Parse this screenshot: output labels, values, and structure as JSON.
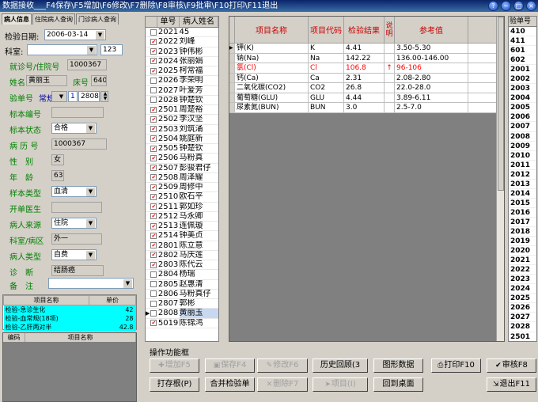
{
  "window": {
    "title": "数据接收___F4保存\\F5增加\\F6修改\\F7删除\\F8审核\\F9批审\\F10打印\\F11退出"
  },
  "tabs": [
    "病人信息",
    "住院病人查询",
    "门诊病人查询"
  ],
  "form": {
    "test_date_label": "检验日期:",
    "test_date": "2006-03-14",
    "dept_label": "科室:",
    "dept_value": "",
    "dept_code": "123",
    "visit_no_label": "就诊号/住院号",
    "visit_no": "1000367",
    "name_label": "姓名",
    "name": "黄丽玉",
    "bed_label": "床号",
    "bed": "640",
    "test_no_label": "验单号",
    "test_type": "常规",
    "test_flag": "1",
    "test_no": "2808",
    "specimen_no_label": "标本编号",
    "specimen_no": "",
    "specimen_state_label": "标本状态",
    "specimen_state": "合格",
    "record_no_label": "病 历 号",
    "record_no": "1000367",
    "sex_label": "性　别",
    "sex": "女",
    "age_label": "年　龄",
    "age": "63",
    "sample_type_label": "样本类型",
    "sample_type": "血清",
    "doctor_label": "开单医生",
    "doctor": "",
    "source_label": "病人来源",
    "source": "住院",
    "ward_label": "科室/病区",
    "ward": "外一",
    "patient_type_label": "病人类型",
    "patient_type": "自费",
    "diagnosis_label": "诊　断",
    "diagnosis": "结肠癌",
    "remark_label": "备　注",
    "remark": ""
  },
  "fees": {
    "headers": [
      "项目名称",
      "单价"
    ],
    "rows": [
      {
        "name": "检验-急诊生化",
        "price": "42"
      },
      {
        "name": "检验-血常规(18项)",
        "price": "28"
      },
      {
        "name": "检验-乙肝两对半",
        "price": "42.8"
      }
    ]
  },
  "codes_table": {
    "headers": [
      "编码",
      "项目名称"
    ]
  },
  "patients": {
    "headers": [
      "单号",
      "病人姓名"
    ],
    "rows": [
      {
        "no": "2021",
        "name": "45",
        "checked": false
      },
      {
        "no": "2022",
        "name": "刘峰",
        "checked": true
      },
      {
        "no": "2023",
        "name": "钟伟彬",
        "checked": true
      },
      {
        "no": "2024",
        "name": "张丽娟",
        "checked": true
      },
      {
        "no": "2025",
        "name": "柯常福",
        "checked": true
      },
      {
        "no": "2026",
        "name": "李荣明",
        "checked": false
      },
      {
        "no": "2027",
        "name": "叶爱芳",
        "checked": false
      },
      {
        "no": "2028",
        "name": "钟楚钦",
        "checked": false
      },
      {
        "no": "2501",
        "name": "周楚裕",
        "checked": true
      },
      {
        "no": "2502",
        "name": "李汉坚",
        "checked": true
      },
      {
        "no": "2503",
        "name": "刘筑涌",
        "checked": true
      },
      {
        "no": "2504",
        "name": "姚庭新",
        "checked": true
      },
      {
        "no": "2505",
        "name": "钟楚钦",
        "checked": true
      },
      {
        "no": "2506",
        "name": "马粉真",
        "checked": true
      },
      {
        "no": "2507",
        "name": "彭骏君仔",
        "checked": true
      },
      {
        "no": "2508",
        "name": "周泽耀",
        "checked": true
      },
      {
        "no": "2509",
        "name": "周修中",
        "checked": true
      },
      {
        "no": "2510",
        "name": "欧石平",
        "checked": true
      },
      {
        "no": "2511",
        "name": "郭如珍",
        "checked": true
      },
      {
        "no": "2512",
        "name": "马永卿",
        "checked": true
      },
      {
        "no": "2513",
        "name": "连佩璇",
        "checked": true
      },
      {
        "no": "2514",
        "name": "钟美贞",
        "checked": true
      },
      {
        "no": "2801",
        "name": "陈立意",
        "checked": true
      },
      {
        "no": "2802",
        "name": "马庆莲",
        "checked": true
      },
      {
        "no": "2803",
        "name": "陈代云",
        "checked": true
      },
      {
        "no": "2804",
        "name": "杨瑞",
        "checked": false
      },
      {
        "no": "2805",
        "name": "赵惠清",
        "checked": false
      },
      {
        "no": "2806",
        "name": "马粉真仔",
        "checked": false
      },
      {
        "no": "2807",
        "name": "郭彬",
        "checked": false
      },
      {
        "no": "2808",
        "name": "黄丽玉",
        "checked": false,
        "selected": true
      },
      {
        "no": "5019",
        "name": "陈锦鸿",
        "checked": true
      }
    ]
  },
  "results": {
    "headers": [
      "项目名称",
      "项目代码",
      "检验结果",
      "说明",
      "参考值"
    ],
    "rows": [
      {
        "name": "钾(K)",
        "code": "K",
        "value": "4.41",
        "flag": "",
        "ref": "3.50-5.30",
        "high": false,
        "current": true
      },
      {
        "name": "钠(Na)",
        "code": "Na",
        "value": "142.22",
        "flag": "",
        "ref": "136.00-146.00",
        "high": false
      },
      {
        "name": "氯(Cl)",
        "code": "Cl",
        "value": "106.8",
        "flag": "↑",
        "ref": "96-106",
        "high": true
      },
      {
        "name": "钙(Ca)",
        "code": "Ca",
        "value": "2.31",
        "flag": "",
        "ref": "2.08-2.80",
        "high": false
      },
      {
        "name": "二氧化碳(CO2)",
        "code": "CO2",
        "value": "26.8",
        "flag": "",
        "ref": "22.0-28.0",
        "high": false
      },
      {
        "name": "葡萄糖(GLU)",
        "code": "GLU",
        "value": "4.44",
        "flag": "",
        "ref": "3.89-6.11",
        "high": false
      },
      {
        "name": "尿素氮(BUN)",
        "code": "BUN",
        "value": "3.0",
        "flag": "",
        "ref": "2.5-7.0",
        "high": false
      }
    ]
  },
  "test_codes": {
    "header": "验单号",
    "rows": [
      "410",
      "411",
      "601",
      "602",
      "2001",
      "2002",
      "2003",
      "2004",
      "2005",
      "2006",
      "2007",
      "2008",
      "2009",
      "2010",
      "2011",
      "2012",
      "2013",
      "2014",
      "2015",
      "2016",
      "2017",
      "2018",
      "2019",
      "2020",
      "2021",
      "2022",
      "2023",
      "2024",
      "2025",
      "2026",
      "2027",
      "2028",
      "2501",
      "2502",
      "2503",
      "2504",
      "2505",
      "2506",
      "2507"
    ]
  },
  "ops": {
    "label": "操作功能框",
    "buttons": {
      "add": "增加F5",
      "save": "保存F4",
      "modify": "修改F6",
      "history": "历史回顾(3",
      "graph": "图形数据",
      "print": "打印F10",
      "audit": "审核F8",
      "print_report": "打存根(P)",
      "merge": "合并检验单",
      "delete": "删除F7",
      "item": "项目(I)",
      "desktop": "回到桌面",
      "exit": "退出F11"
    }
  }
}
